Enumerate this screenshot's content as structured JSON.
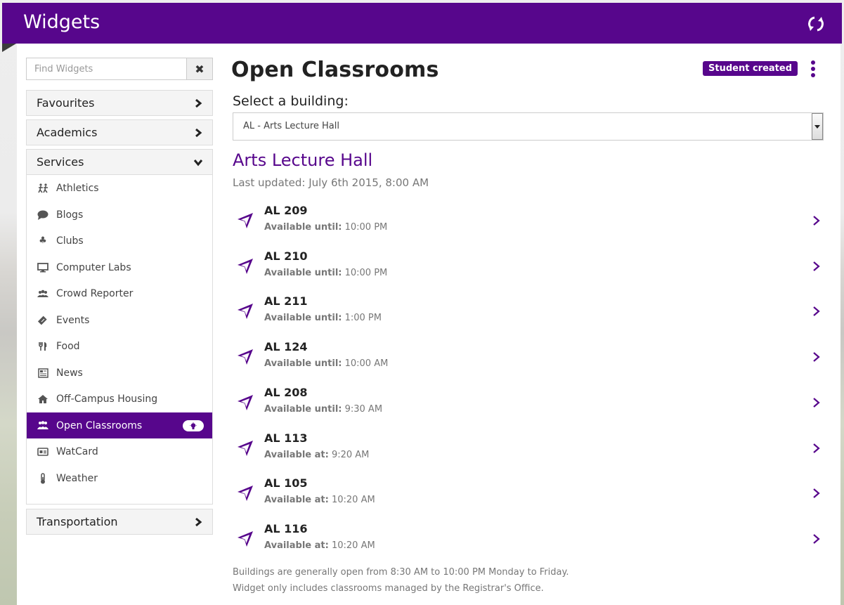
{
  "app": {
    "title": "Widgets",
    "refresh_icon": "refresh-icon",
    "brand_color": "#57068c"
  },
  "sidebar": {
    "search": {
      "placeholder": "Find Widgets",
      "value": "",
      "clear_icon": "close-icon"
    },
    "categories": [
      {
        "label": "Favourites",
        "state": "collapsed"
      },
      {
        "label": "Academics",
        "state": "collapsed"
      },
      {
        "label": "Services",
        "state": "expanded"
      },
      {
        "label": "Transportation",
        "state": "collapsed"
      }
    ],
    "services": [
      {
        "label": "Athletics",
        "icon": "running-people-icon"
      },
      {
        "label": "Blogs",
        "icon": "speech-bubble-icon"
      },
      {
        "label": "Clubs",
        "icon": "club-suit-icon"
      },
      {
        "label": "Computer Labs",
        "icon": "monitor-icon"
      },
      {
        "label": "Crowd Reporter",
        "icon": "group-icon"
      },
      {
        "label": "Events",
        "icon": "ticket-icon"
      },
      {
        "label": "Food",
        "icon": "cutlery-icon"
      },
      {
        "label": "News",
        "icon": "newspaper-icon"
      },
      {
        "label": "Off-Campus Housing",
        "icon": "home-icon"
      },
      {
        "label": "Open Classrooms",
        "icon": "users-icon",
        "active": true,
        "badge_icon": "lightbulb-icon"
      },
      {
        "label": "WatCard",
        "icon": "id-card-icon"
      },
      {
        "label": "Weather",
        "icon": "thermometer-icon"
      }
    ]
  },
  "main": {
    "title": "Open Classrooms",
    "badge": "Student created",
    "select_label": "Select a building:",
    "selected_building": "AL - Arts Lecture Hall",
    "building_name": "Arts Lecture Hall",
    "last_updated": "Last updated: July 6th 2015, 8:00 AM",
    "rooms": [
      {
        "name": "AL 209",
        "label": "Available until:",
        "time": "10:00 PM"
      },
      {
        "name": "AL 210",
        "label": "Available until:",
        "time": "10:00 PM"
      },
      {
        "name": "AL 211",
        "label": "Available until:",
        "time": "1:00 PM"
      },
      {
        "name": "AL 124",
        "label": "Available until:",
        "time": "10:00 AM"
      },
      {
        "name": "AL 208",
        "label": "Available until:",
        "time": "9:30 AM"
      },
      {
        "name": "AL 113",
        "label": "Available at:",
        "time": "9:20 AM"
      },
      {
        "name": "AL 105",
        "label": "Available at:",
        "time": "10:20 AM"
      },
      {
        "name": "AL 116",
        "label": "Available at:",
        "time": "10:20 AM"
      }
    ],
    "footnotes": [
      "Buildings are generally open from 8:30 AM to 10:00 PM Monday to Friday.",
      "Widget only includes classrooms managed by the Registrar's Office."
    ]
  }
}
